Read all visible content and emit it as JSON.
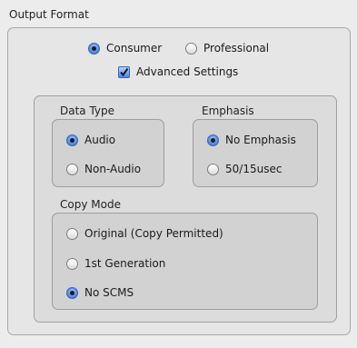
{
  "output_format": {
    "title": "Output Format",
    "consumer_label": "Consumer",
    "professional_label": "Professional",
    "selected": "Consumer",
    "advanced_settings_label": "Advanced Settings",
    "advanced_settings_checked": true
  },
  "data_type": {
    "title": "Data Type",
    "audio_label": "Audio",
    "non_audio_label": "Non-Audio",
    "selected": "Audio"
  },
  "emphasis": {
    "title": "Emphasis",
    "no_emphasis_label": "No Emphasis",
    "emphasis_50_15_label": "50/15usec",
    "selected": "No Emphasis"
  },
  "copy_mode": {
    "title": "Copy Mode",
    "original_label": "Original (Copy Permitted)",
    "first_generation_label": "1st Generation",
    "no_scms_label": "No SCMS",
    "selected": "No SCMS"
  },
  "colors": {
    "accent": "#2f62c4",
    "background": "#ececec"
  }
}
